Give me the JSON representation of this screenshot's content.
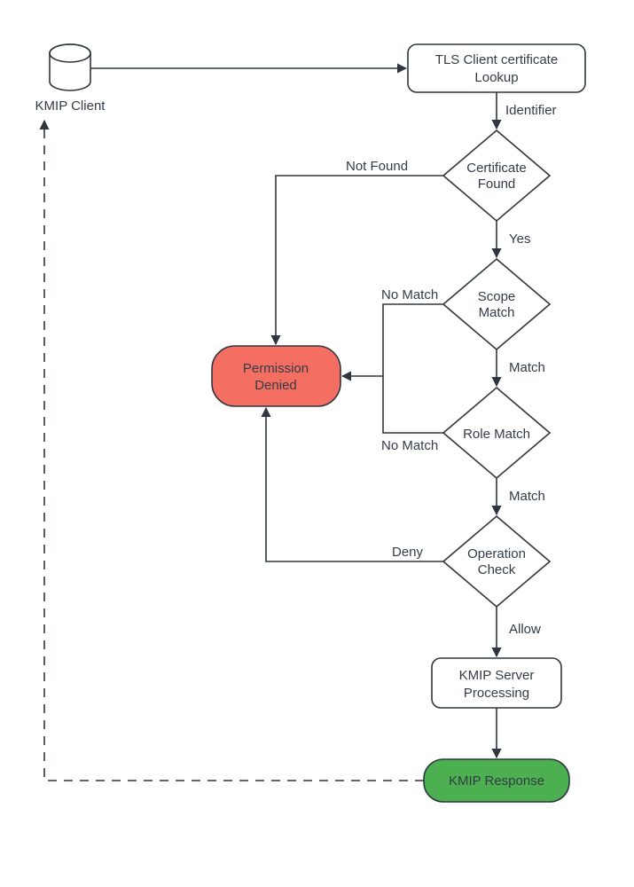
{
  "nodes": {
    "client": {
      "line1": "KMIP Client"
    },
    "tls_lookup": {
      "line1": "TLS Client certificate",
      "line2": "Lookup"
    },
    "cert_found": {
      "line1": "Certificate",
      "line2": "Found"
    },
    "scope_match": {
      "line1": "Scope",
      "line2": "Match"
    },
    "role_match": {
      "line1": "Role Match"
    },
    "op_check": {
      "line1": "Operation",
      "line2": "Check"
    },
    "denied": {
      "line1": "Permission",
      "line2": "Denied"
    },
    "server_proc": {
      "line1": "KMIP Server",
      "line2": "Processing"
    },
    "response": {
      "line1": "KMIP Response"
    }
  },
  "edges": {
    "identifier": "Identifier",
    "cert_not_found": "Not Found",
    "cert_yes": "Yes",
    "scope_no": "No Match",
    "scope_match": "Match",
    "role_no": "No Match",
    "role_match": "Match",
    "op_deny": "Deny",
    "op_allow": "Allow"
  },
  "colors": {
    "stroke": "#2f3640",
    "denied_fill": "#f46e62",
    "ok_fill": "#4caf50"
  }
}
